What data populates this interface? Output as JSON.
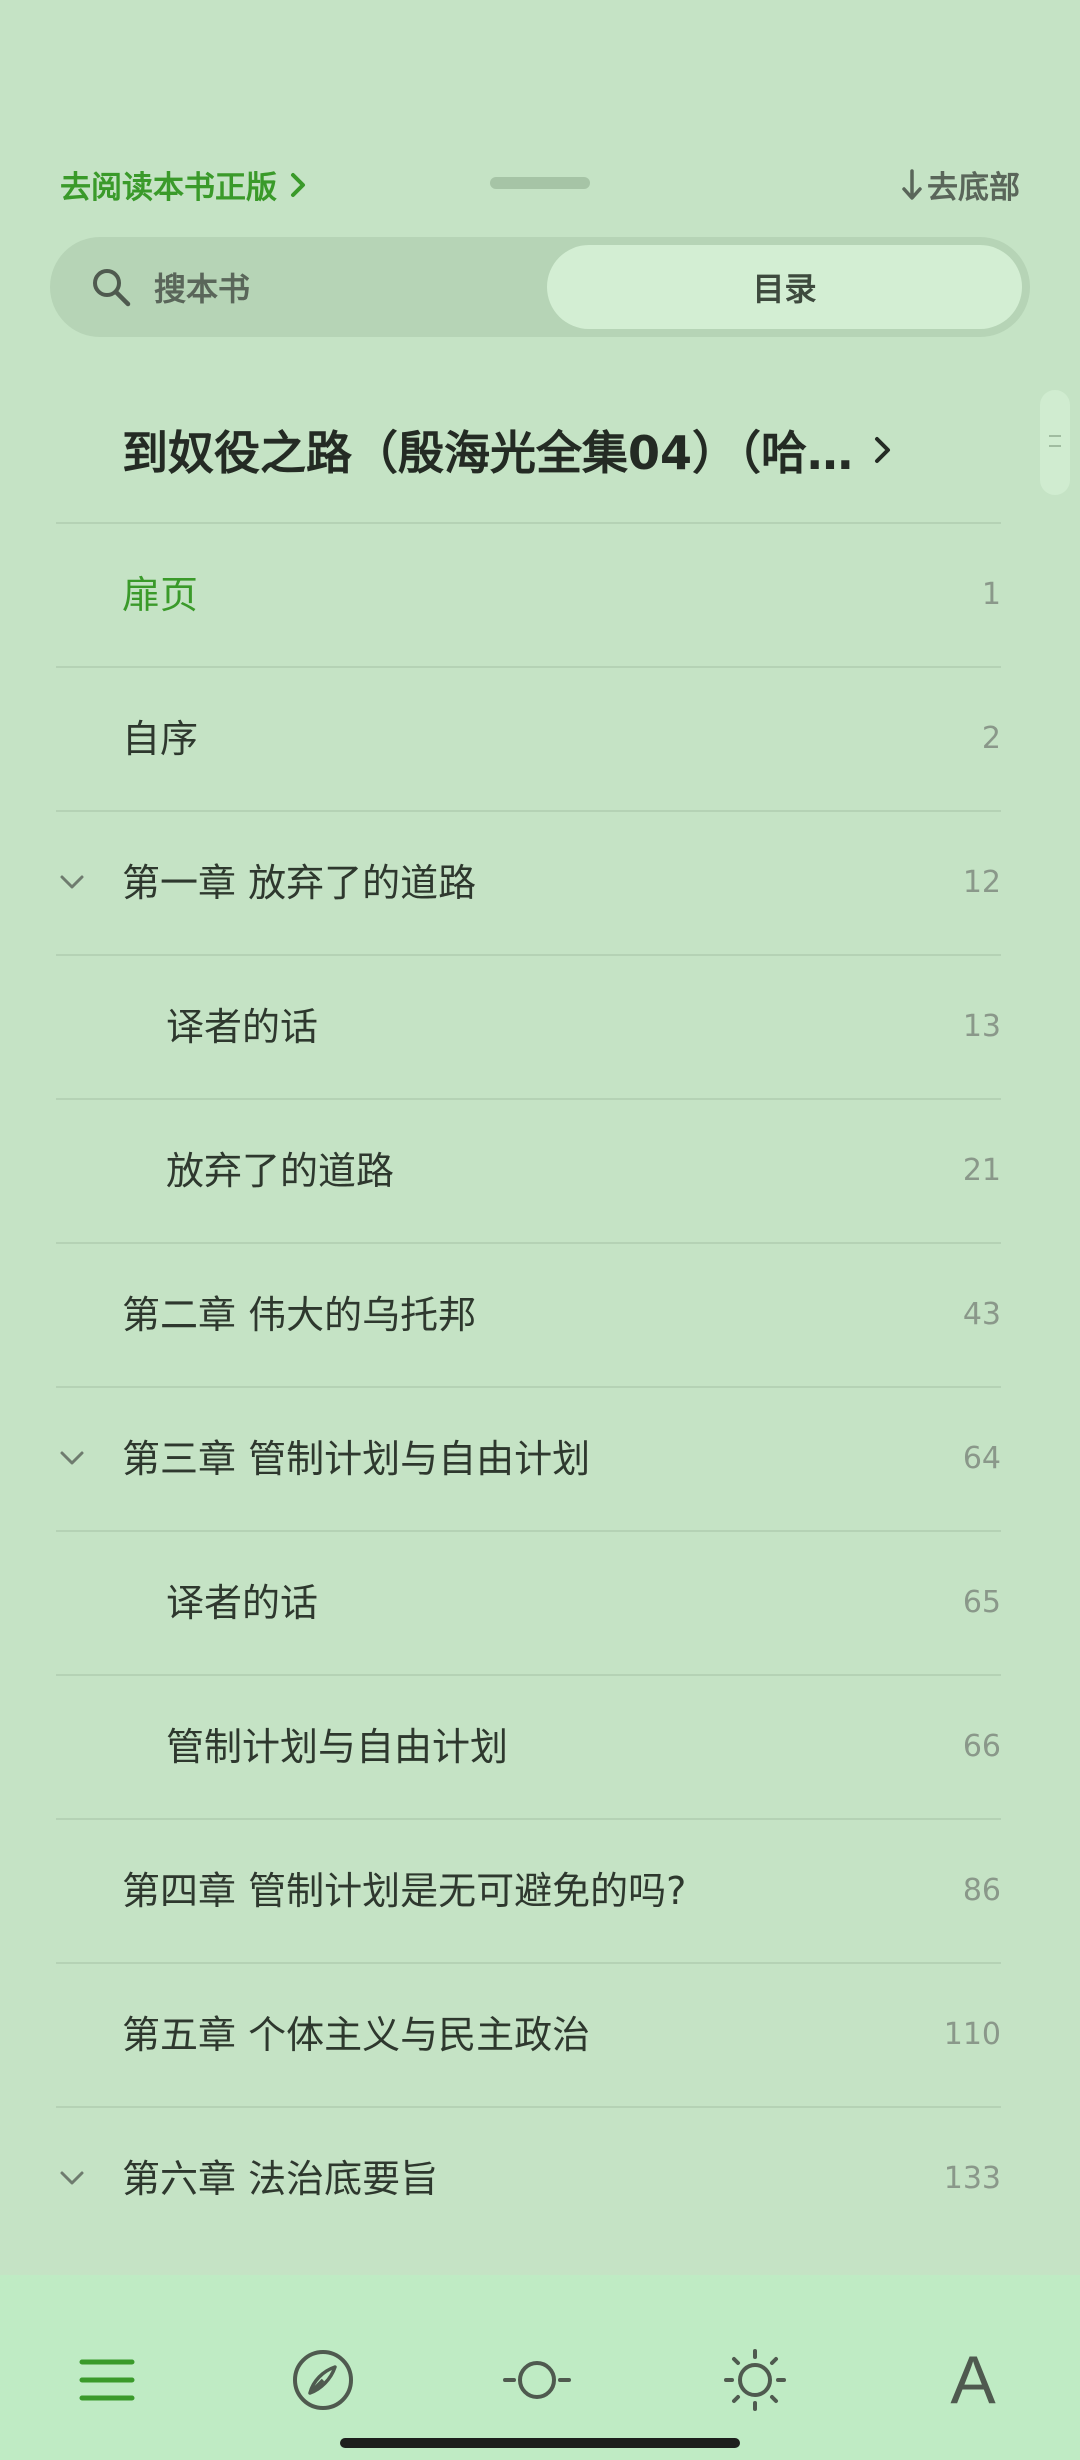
{
  "header": {
    "buy_link": "去阅读本书正版",
    "to_bottom": "去底部"
  },
  "search": {
    "placeholder": "搜本书",
    "toc_tab": "目录"
  },
  "book": {
    "title": "到奴役之路（殷海光全集04）（哈…"
  },
  "toc": [
    {
      "label": "扉页",
      "page": "1",
      "level": 0,
      "expandable": false,
      "active": true
    },
    {
      "label": "自序",
      "page": "2",
      "level": 0,
      "expandable": false,
      "active": false
    },
    {
      "label": "第一章 放弃了的道路",
      "page": "12",
      "level": 0,
      "expandable": true,
      "active": false
    },
    {
      "label": "译者的话",
      "page": "13",
      "level": 1,
      "expandable": false,
      "active": false
    },
    {
      "label": "放弃了的道路",
      "page": "21",
      "level": 1,
      "expandable": false,
      "active": false
    },
    {
      "label": "第二章 伟大的乌托邦",
      "page": "43",
      "level": 0,
      "expandable": false,
      "active": false
    },
    {
      "label": "第三章 管制计划与自由计划",
      "page": "64",
      "level": 0,
      "expandable": true,
      "active": false
    },
    {
      "label": "译者的话",
      "page": "65",
      "level": 1,
      "expandable": false,
      "active": false
    },
    {
      "label": "管制计划与自由计划",
      "page": "66",
      "level": 1,
      "expandable": false,
      "active": false
    },
    {
      "label": "第四章 管制计划是无可避免的吗?",
      "page": "86",
      "level": 0,
      "expandable": false,
      "active": false
    },
    {
      "label": "第五章 个体主义与民主政治",
      "page": "110",
      "level": 0,
      "expandable": false,
      "active": false
    },
    {
      "label": "第六章 法治底要旨",
      "page": "133",
      "level": 0,
      "expandable": true,
      "active": false
    }
  ],
  "toolbar": {
    "font_label": "A"
  },
  "colors": {
    "background": "#c5e3c5",
    "accent": "#3a9a2a",
    "toolbar": "#bfebc4"
  }
}
